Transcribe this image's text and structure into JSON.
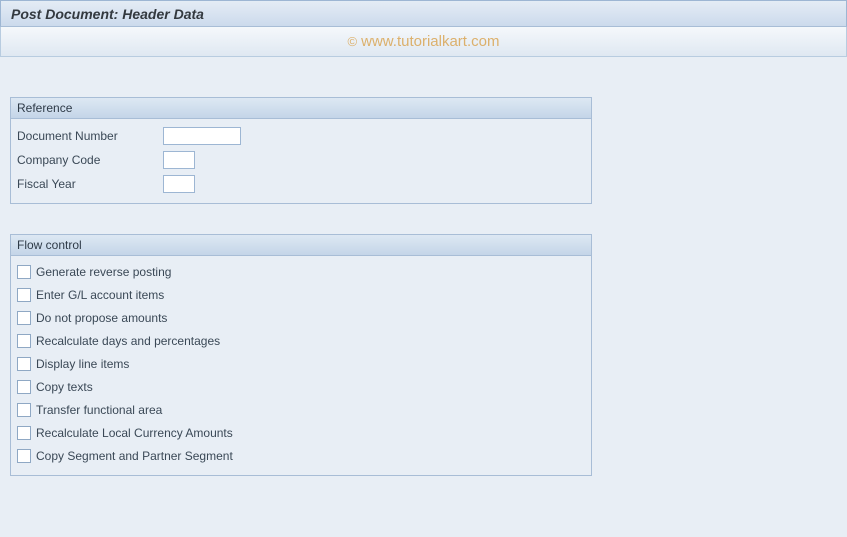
{
  "title": "Post Document: Header Data",
  "watermark": {
    "copyright": "©",
    "text": "www.tutorialkart.com"
  },
  "reference": {
    "header": "Reference",
    "fields": {
      "doc_number": {
        "label": "Document Number",
        "value": ""
      },
      "company_code": {
        "label": "Company Code",
        "value": ""
      },
      "fiscal_year": {
        "label": "Fiscal Year",
        "value": ""
      }
    }
  },
  "flow_control": {
    "header": "Flow control",
    "items": [
      {
        "label": "Generate reverse posting",
        "checked": false
      },
      {
        "label": "Enter G/L account items",
        "checked": false
      },
      {
        "label": "Do not propose amounts",
        "checked": false
      },
      {
        "label": "Recalculate days and percentages",
        "checked": false
      },
      {
        "label": "Display line items",
        "checked": false
      },
      {
        "label": "Copy texts",
        "checked": false
      },
      {
        "label": "Transfer functional area",
        "checked": false
      },
      {
        "label": "Recalculate Local Currency Amounts",
        "checked": false
      },
      {
        "label": "Copy Segment and Partner Segment",
        "checked": false
      }
    ]
  }
}
